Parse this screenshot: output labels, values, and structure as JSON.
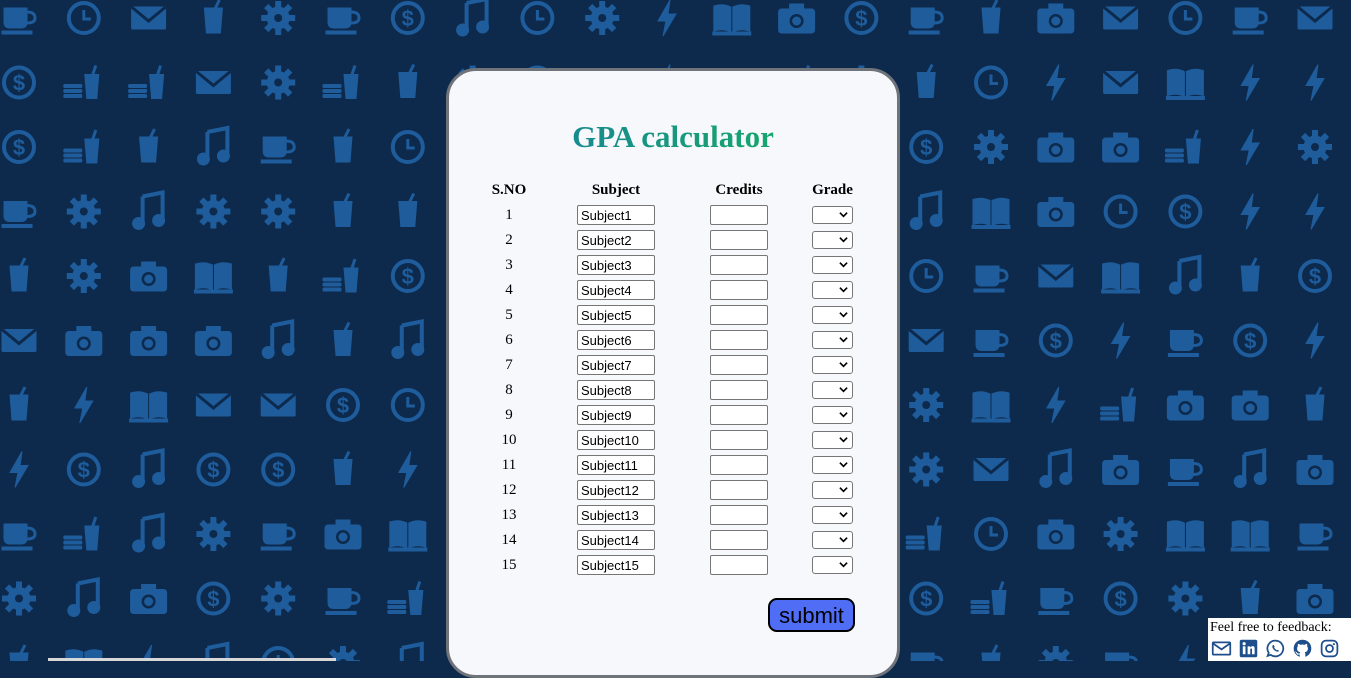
{
  "app": {
    "title": "GPA calculator"
  },
  "table": {
    "headers": {
      "sno": "S.NO",
      "subject": "Subject",
      "credits": "Credits",
      "grade": "Grade"
    },
    "rows": [
      {
        "sno": "1",
        "subject": "Subject1",
        "credits": "",
        "grade": ""
      },
      {
        "sno": "2",
        "subject": "Subject2",
        "credits": "",
        "grade": ""
      },
      {
        "sno": "3",
        "subject": "Subject3",
        "credits": "",
        "grade": ""
      },
      {
        "sno": "4",
        "subject": "Subject4",
        "credits": "",
        "grade": ""
      },
      {
        "sno": "5",
        "subject": "Subject5",
        "credits": "",
        "grade": ""
      },
      {
        "sno": "6",
        "subject": "Subject6",
        "credits": "",
        "grade": ""
      },
      {
        "sno": "7",
        "subject": "Subject7",
        "credits": "",
        "grade": ""
      },
      {
        "sno": "8",
        "subject": "Subject8",
        "credits": "",
        "grade": ""
      },
      {
        "sno": "9",
        "subject": "Subject9",
        "credits": "",
        "grade": ""
      },
      {
        "sno": "10",
        "subject": "Subject10",
        "credits": "",
        "grade": ""
      },
      {
        "sno": "11",
        "subject": "Subject11",
        "credits": "",
        "grade": ""
      },
      {
        "sno": "12",
        "subject": "Subject12",
        "credits": "",
        "grade": ""
      },
      {
        "sno": "13",
        "subject": "Subject13",
        "credits": "",
        "grade": ""
      },
      {
        "sno": "14",
        "subject": "Subject14",
        "credits": "",
        "grade": ""
      },
      {
        "sno": "15",
        "subject": "Subject15",
        "credits": "",
        "grade": ""
      }
    ]
  },
  "actions": {
    "submit_label": "submit"
  },
  "feedback": {
    "label": "Feel free to feedback:",
    "icons": [
      "mail-icon",
      "linkedin-icon",
      "whatsapp-icon",
      "github-icon",
      "instagram-icon"
    ]
  },
  "colors": {
    "background": "#0d2a4c",
    "pattern_icons": "#1e5c9c",
    "card": "#f7f8fc",
    "card_border": "#6f737a",
    "title_gradient_start": "#1a7aa4",
    "title_gradient_end": "#1ed06a",
    "submit_button": "#4f6df5",
    "feedback_icons": "#1e4f8c"
  },
  "background_pattern_icons": [
    "dollar-icon",
    "mail-icon",
    "drink-icon",
    "bolt-icon",
    "gear-icon",
    "coffee-icon",
    "clock-icon",
    "camera-icon",
    "book-icon",
    "music-icon",
    "burger-drink-icon"
  ]
}
